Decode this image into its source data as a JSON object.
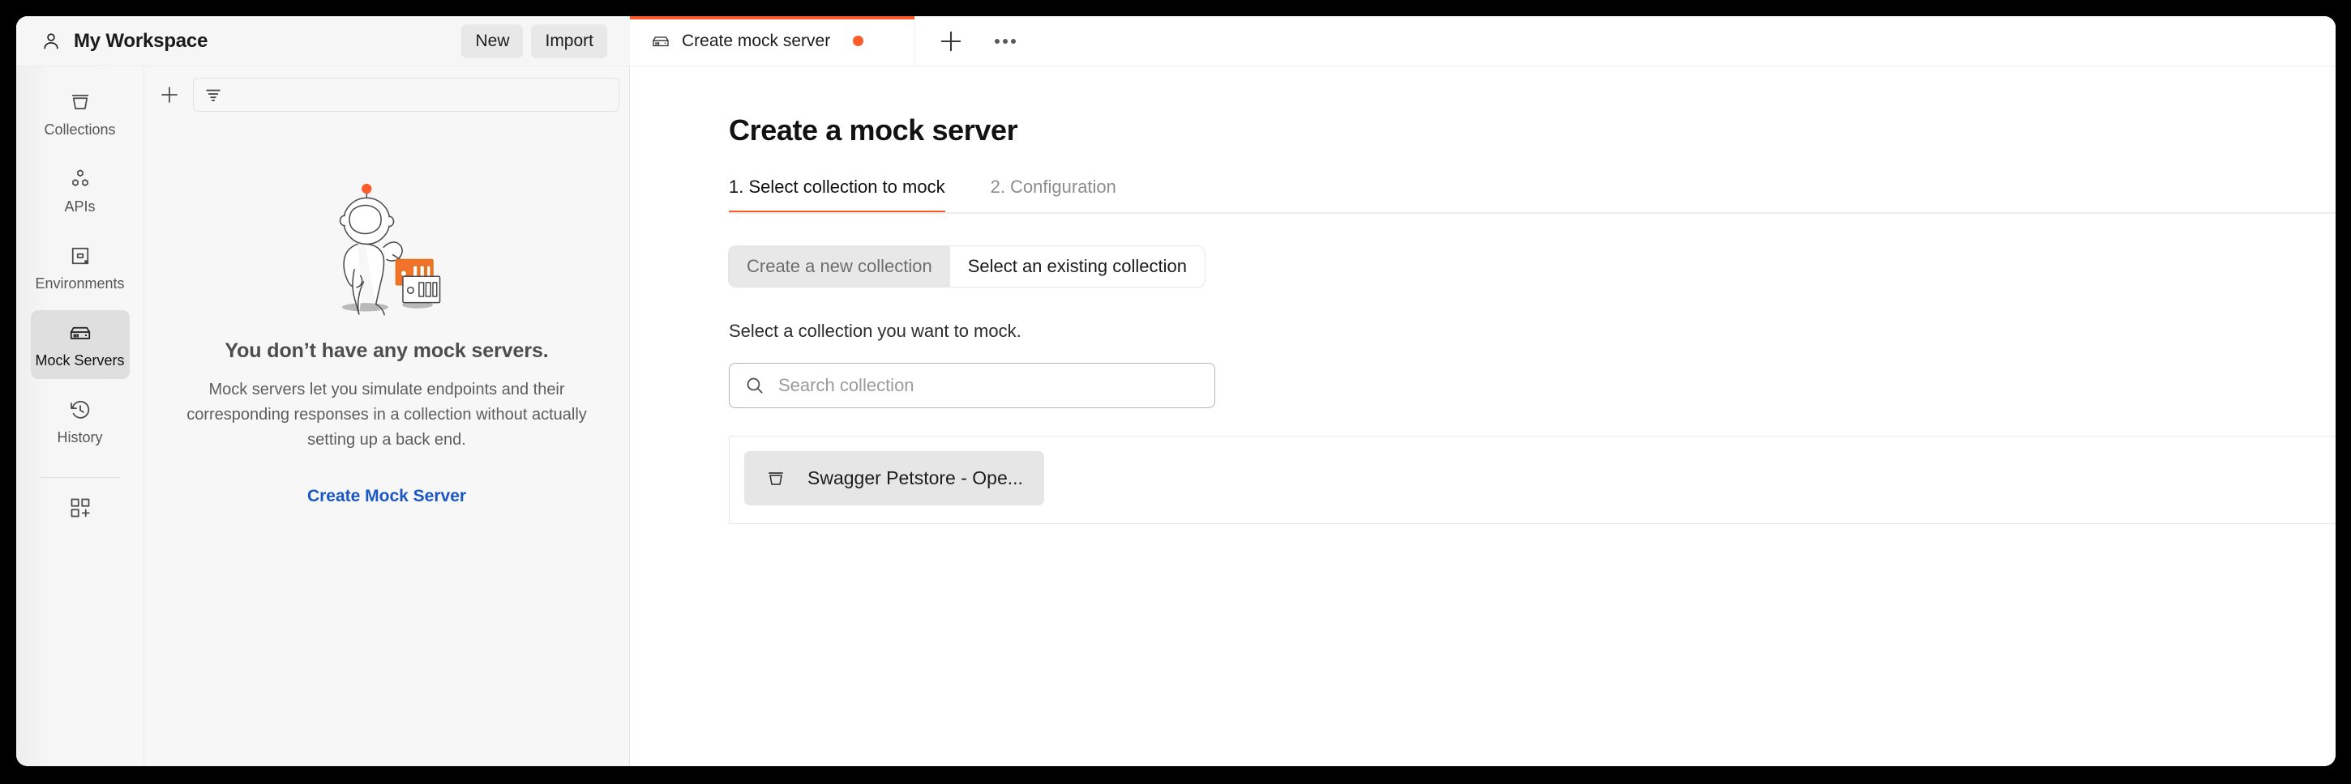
{
  "workspace": {
    "icon": "user-icon",
    "title": "My Workspace",
    "new_label": "New",
    "import_label": "Import"
  },
  "tabs": {
    "items": [
      {
        "label": "Create mock server",
        "icon": "mock-server-icon",
        "unsaved": true,
        "active": true
      }
    ],
    "new_tab_icon": "plus-icon",
    "more_icon": "ellipsis-icon"
  },
  "sidebar": {
    "items": [
      {
        "label": "Collections",
        "icon": "collections-icon",
        "active": false
      },
      {
        "label": "APIs",
        "icon": "apis-icon",
        "active": false
      },
      {
        "label": "Environments",
        "icon": "environments-icon",
        "active": false
      },
      {
        "label": "Mock Servers",
        "icon": "mock-server-icon",
        "active": true
      },
      {
        "label": "History",
        "icon": "history-icon",
        "active": false
      }
    ],
    "bottom_icon": "add-module-icon"
  },
  "panel": {
    "add_icon": "plus-icon",
    "filter_icon": "filter-icon",
    "filter_placeholder": "",
    "empty": {
      "illustration": "astronaut-with-servers-illustration",
      "title": "You don’t have any mock servers.",
      "description": "Mock servers let you simulate endpoints and their corresponding responses in a collection without actually setting up a back end.",
      "cta_label": "Create Mock Server"
    }
  },
  "main": {
    "title": "Create a mock server",
    "steps": [
      {
        "label": "1. Select collection to mock",
        "active": true
      },
      {
        "label": "2. Configuration",
        "active": false
      }
    ],
    "segmented": [
      {
        "label": "Create a new collection",
        "active": false
      },
      {
        "label": "Select an existing collection",
        "active": true
      }
    ],
    "hint": "Select a collection you want to mock.",
    "search": {
      "icon": "search-icon",
      "placeholder": "Search collection",
      "value": ""
    },
    "collections": [
      {
        "label": "Swagger Petstore - Ope...",
        "icon": "collection-icon",
        "selected": true
      }
    ]
  },
  "colors": {
    "accent_orange": "#ff5c2c",
    "link_blue": "#1a57c4",
    "panel_bg": "#f7f7f7",
    "selected_gray": "#e6e6e6"
  }
}
